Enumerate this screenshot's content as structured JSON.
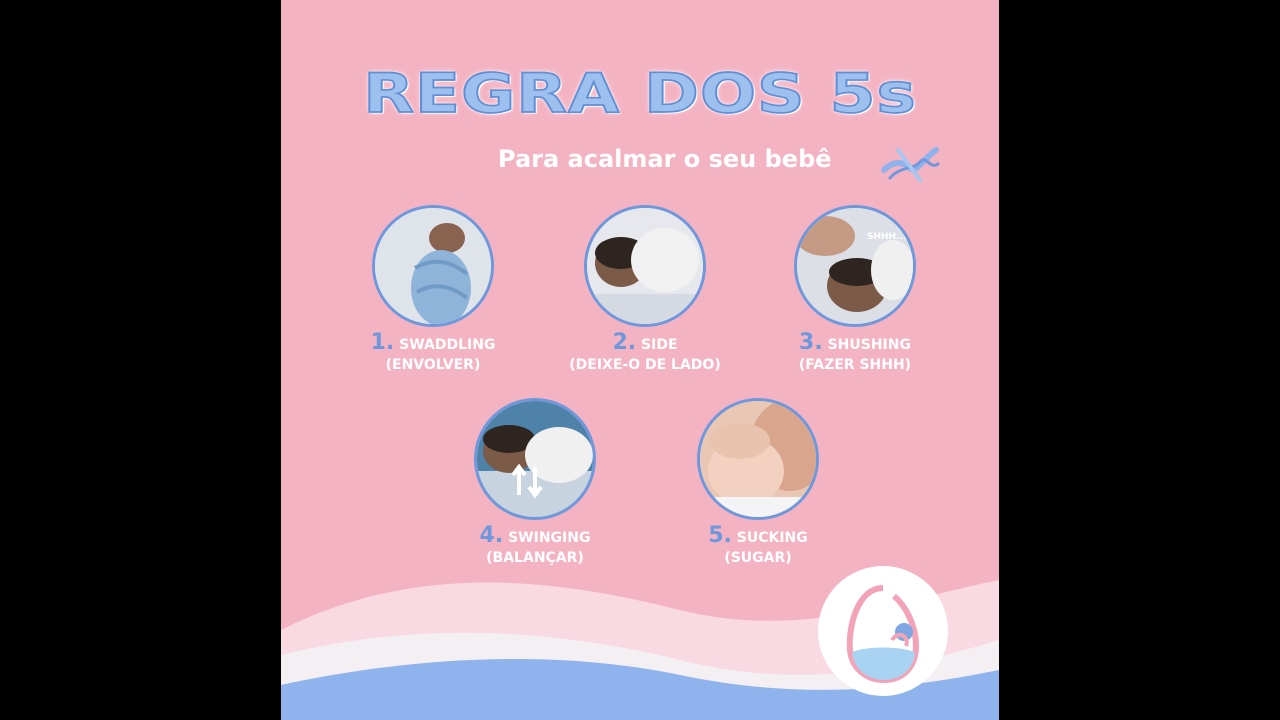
{
  "poster": {
    "title": "REGRA DOS 5s",
    "subtitle": "Para acalmar o seu bebê",
    "colors": {
      "background": "#f4b3c3",
      "accent_blue": "#6f98dc",
      "text": "#ffffff"
    }
  },
  "steps": [
    {
      "number": "1",
      "name": "SWADDLING",
      "translation": "(ENVOLVER)",
      "icon": "swaddled-baby-photo"
    },
    {
      "number": "2",
      "name": "SIDE",
      "translation": "(DEIXE-O DE LADO)",
      "icon": "baby-on-side-photo"
    },
    {
      "number": "3",
      "name": "SHUSHING",
      "translation": "(FAZER SHHH)",
      "icon": "shushing-baby-photo",
      "bubble_text": "SHHH..."
    },
    {
      "number": "4",
      "name": "SWINGING",
      "translation": "(BALANÇAR)",
      "icon": "swinging-baby-photo"
    },
    {
      "number": "5",
      "name": "SUCKING",
      "translation": "(SUGAR)",
      "icon": "sucking-baby-photo"
    }
  ],
  "logo": {
    "icon": "drop-baby-logo"
  }
}
